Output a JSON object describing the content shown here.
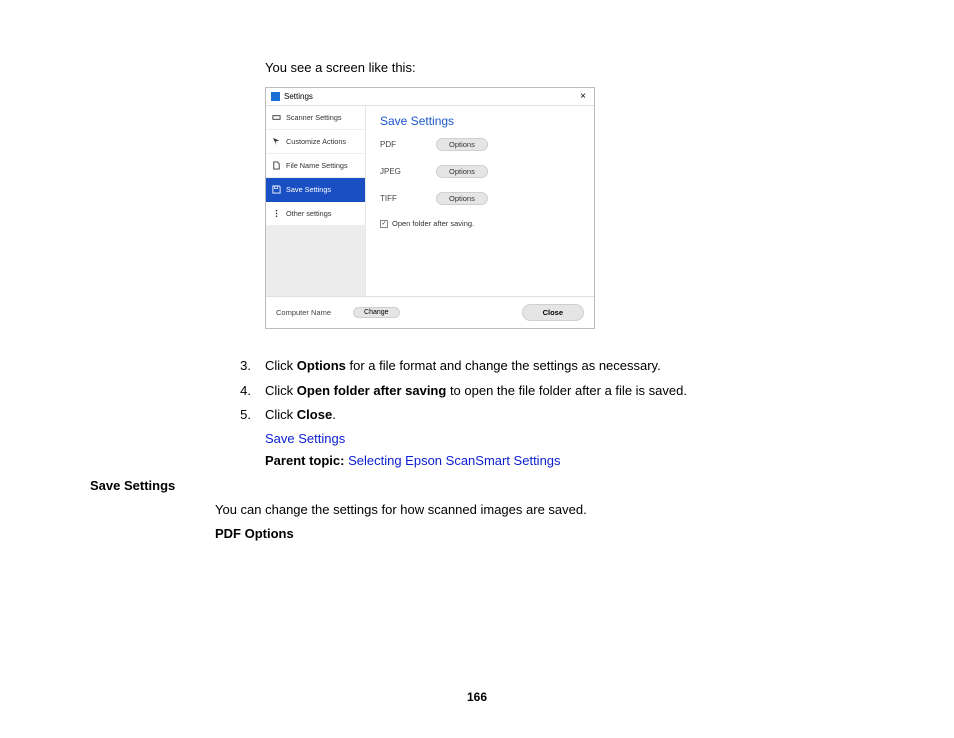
{
  "intro": "You see a screen like this:",
  "dialog": {
    "title": "Settings",
    "close_x": "×",
    "nav": [
      {
        "label": "Scanner Settings"
      },
      {
        "label": "Customize Actions"
      },
      {
        "label": "File Name Settings"
      },
      {
        "label": "Save Settings"
      },
      {
        "label": "Other settings"
      }
    ],
    "panel_title": "Save Settings",
    "rows": [
      {
        "name": "PDF",
        "btn": "Options"
      },
      {
        "name": "JPEG",
        "btn": "Options"
      },
      {
        "name": "TIFF",
        "btn": "Options"
      }
    ],
    "checkbox_label": "Open folder after saving.",
    "footer": {
      "computer_name_label": "Computer Name",
      "change": "Change",
      "close": "Close"
    }
  },
  "steps": [
    {
      "n": "3.",
      "pre": "Click ",
      "b": "Options",
      "post": " for a file format and change the settings as necessary."
    },
    {
      "n": "4.",
      "pre": "Click ",
      "b": "Open folder after saving",
      "post": " to open the file folder after a file is saved."
    },
    {
      "n": "5.",
      "pre": "Click ",
      "b": "Close",
      "post": "."
    }
  ],
  "link_save_settings": "Save Settings",
  "parent_topic_label": "Parent topic: ",
  "parent_topic_link": "Selecting Epson ScanSmart Settings",
  "subheading": "Save Settings",
  "body_text": "You can change the settings for how scanned images are saved.",
  "pdf_options": "PDF Options",
  "page_number": "166"
}
